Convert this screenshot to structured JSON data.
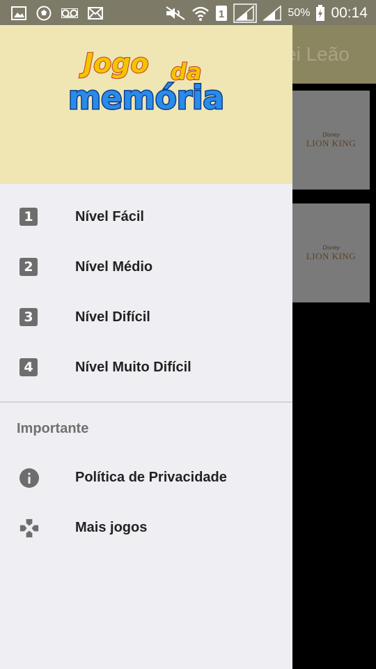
{
  "status_bar": {
    "battery_percent": "50%",
    "time": "00:14",
    "left_icons": [
      "image-icon",
      "soccer-icon",
      "voicemail-icon",
      "mail-icon"
    ],
    "right_icons": [
      "mute-icon",
      "wifi-icon",
      "sim-icon",
      "signal-icon",
      "signal-icon",
      "battery-icon"
    ]
  },
  "background_app": {
    "title": "ei Leão",
    "cards": [
      {
        "brand": "Disney",
        "title": "LION KING"
      },
      {
        "brand": "Disney",
        "title": "LION KING"
      }
    ]
  },
  "drawer": {
    "logo": {
      "line1": "Jogo",
      "line1b": "da",
      "line2": "memória"
    },
    "levels": [
      {
        "number": "1",
        "label": "Nível Fácil"
      },
      {
        "number": "2",
        "label": "Nível Médio"
      },
      {
        "number": "3",
        "label": "Nível Difícil"
      },
      {
        "number": "4",
        "label": "Nível Muito Difícil"
      }
    ],
    "section_title": "Importante",
    "extras": [
      {
        "icon": "info-icon",
        "label": "Política de Privacidade"
      },
      {
        "icon": "gamepad-icon",
        "label": "Mais jogos"
      }
    ]
  },
  "colors": {
    "drawer_header": "#efe6b3",
    "drawer_bg": "#efeef2",
    "icon_gray": "#6d6d6d",
    "logo_blue": "#1f6fd0",
    "logo_yellow": "#f5c400"
  }
}
